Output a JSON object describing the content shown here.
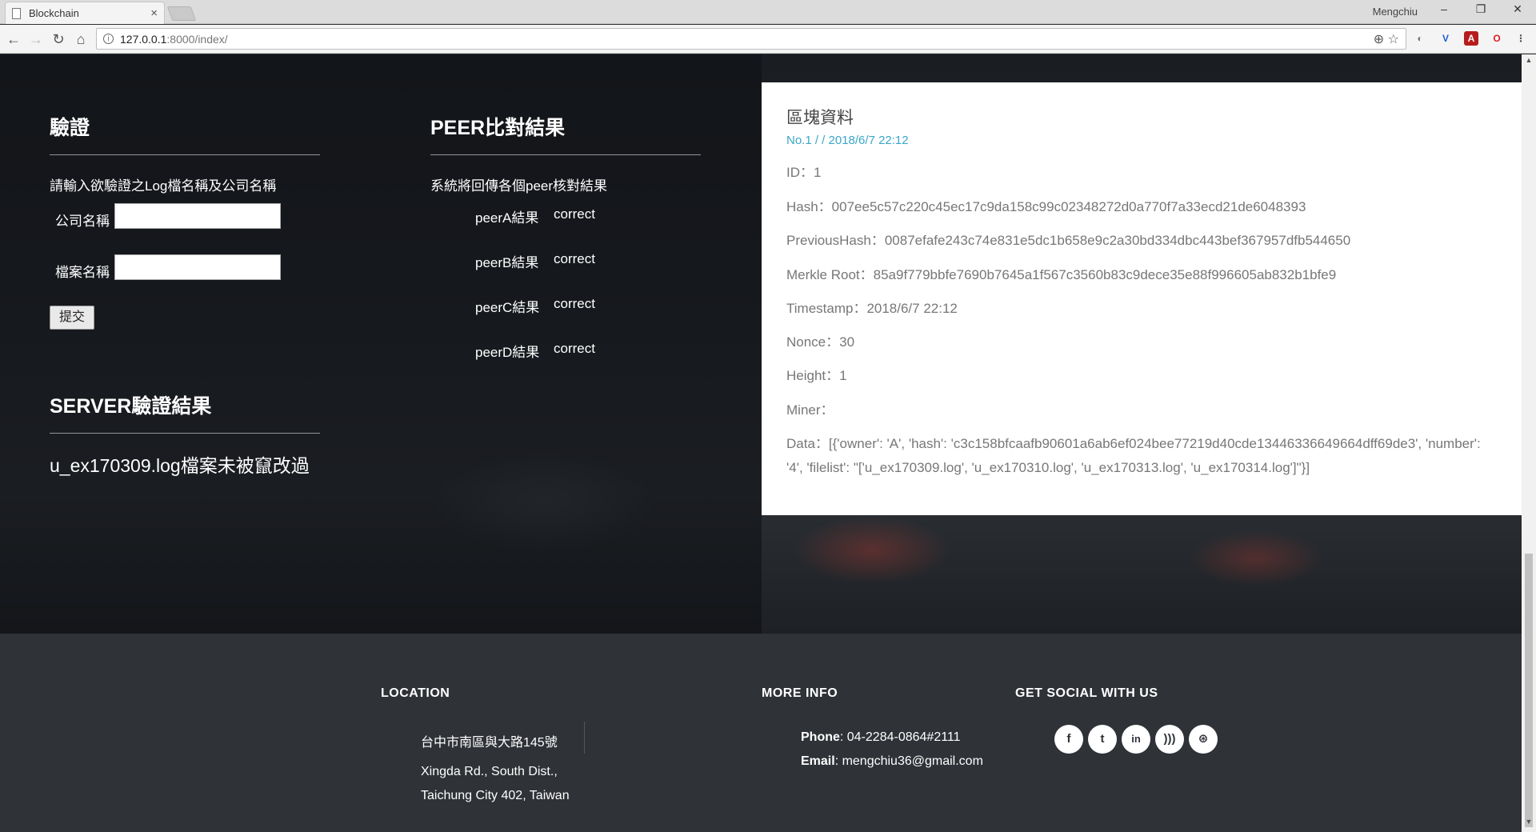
{
  "browser": {
    "tab_title": "Blockchain",
    "tab_close": "×",
    "profile": "Mengchiu",
    "url_host": "127.0.0.1",
    "url_path": ":8000/index/",
    "window_min": "–",
    "window_restore": "❐",
    "window_close": "✕"
  },
  "verify": {
    "title": "驗證",
    "instruction": "請輸入欲驗證之Log檔名稱及公司名稱",
    "company_label": "公司名稱",
    "company_value": "",
    "file_label": "檔案名稱",
    "file_value": "",
    "submit_label": "提交"
  },
  "peer": {
    "title": "PEER比對結果",
    "description": "系統將回傳各個peer核對結果",
    "results": [
      {
        "name": "peerA結果",
        "value": "correct"
      },
      {
        "name": "peerB結果",
        "value": "correct"
      },
      {
        "name": "peerC結果",
        "value": "correct"
      },
      {
        "name": "peerD結果",
        "value": "correct"
      }
    ]
  },
  "server": {
    "title": "SERVER驗證結果",
    "result": "u_ex170309.log檔案未被竄改過"
  },
  "block": {
    "title": "區塊資料",
    "meta": "No.1 / / 2018/6/7 22:12",
    "id": "ID：1",
    "hash": "Hash：007ee5c57c220c45ec17c9da158c99c02348272d0a770f7a33ecd21de6048393",
    "previous_hash": "PreviousHash：0087efafe243c74e831e5dc1b658e9c2a30bd334dbc443bef367957dfb544650",
    "merkle_root": "Merkle Root：85a9f779bbfe7690b7645a1f567c3560b83c9dece35e88f996605ab832b1bfe9",
    "timestamp": "Timestamp：2018/6/7 22:12",
    "nonce": "Nonce：30",
    "height": "Height：1",
    "miner": "Miner：",
    "data": "Data：[{'owner': 'A', 'hash': 'c3c158bfcaafb90601a6ab6ef024bee77219d40cde13446336649664dff69de3', 'number': '4', 'filelist': \"['u_ex170309.log', 'u_ex170310.log', 'u_ex170313.log', 'u_ex170314.log']\"}]"
  },
  "footer": {
    "location_title": "LOCATION",
    "address_zh": "台中市南區與大路145號",
    "address_en_1": "Xingda Rd., South Dist.,",
    "address_en_2": "Taichung City 402, Taiwan",
    "more_info_title": "MORE INFO",
    "phone_label": "Phone",
    "phone_value": ": 04-2284-0864#2111",
    "email_label": "Email",
    "email_value": ": mengchiu36@gmail.com",
    "social_title": "GET SOCIAL WITH US",
    "social_icons": [
      "facebook-icon",
      "twitter-icon",
      "linkedin-icon",
      "rss-icon",
      "dribbble-icon"
    ]
  }
}
